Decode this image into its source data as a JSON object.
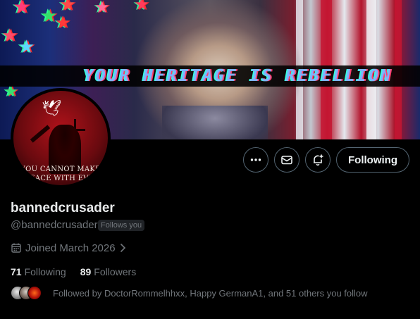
{
  "banner": {
    "text": "YOUR HERITAGE IS REBELLION",
    "colors": {
      "navy": "#1c2f7a",
      "red": "#b5122a",
      "white": "#e4e9ee"
    }
  },
  "avatar": {
    "caption_line1": "YOU CANNOT MAKE",
    "caption_line2": "PEACE WITH EVIL",
    "icon": "dove-icon"
  },
  "actions": {
    "more_icon": "more-icon",
    "message_icon": "mail-icon",
    "notify_icon": "bell-plus-icon",
    "follow_label": "Following"
  },
  "profile": {
    "display_name": "bannedcrusader",
    "handle": "@bannedcrusader",
    "follows_you_badge": "Follows you",
    "joined": "Joined March 2026",
    "following_count": "71",
    "following_label": "Following",
    "followers_count": "89",
    "followers_label": "Followers",
    "followed_by": "Followed by DoctorRommelhhxx, Happy GermanA1, and 51 others you follow"
  },
  "theme": {
    "background": "#000000",
    "text_primary": "#e7e9ea",
    "text_secondary": "#71767b",
    "border": "#536471"
  }
}
